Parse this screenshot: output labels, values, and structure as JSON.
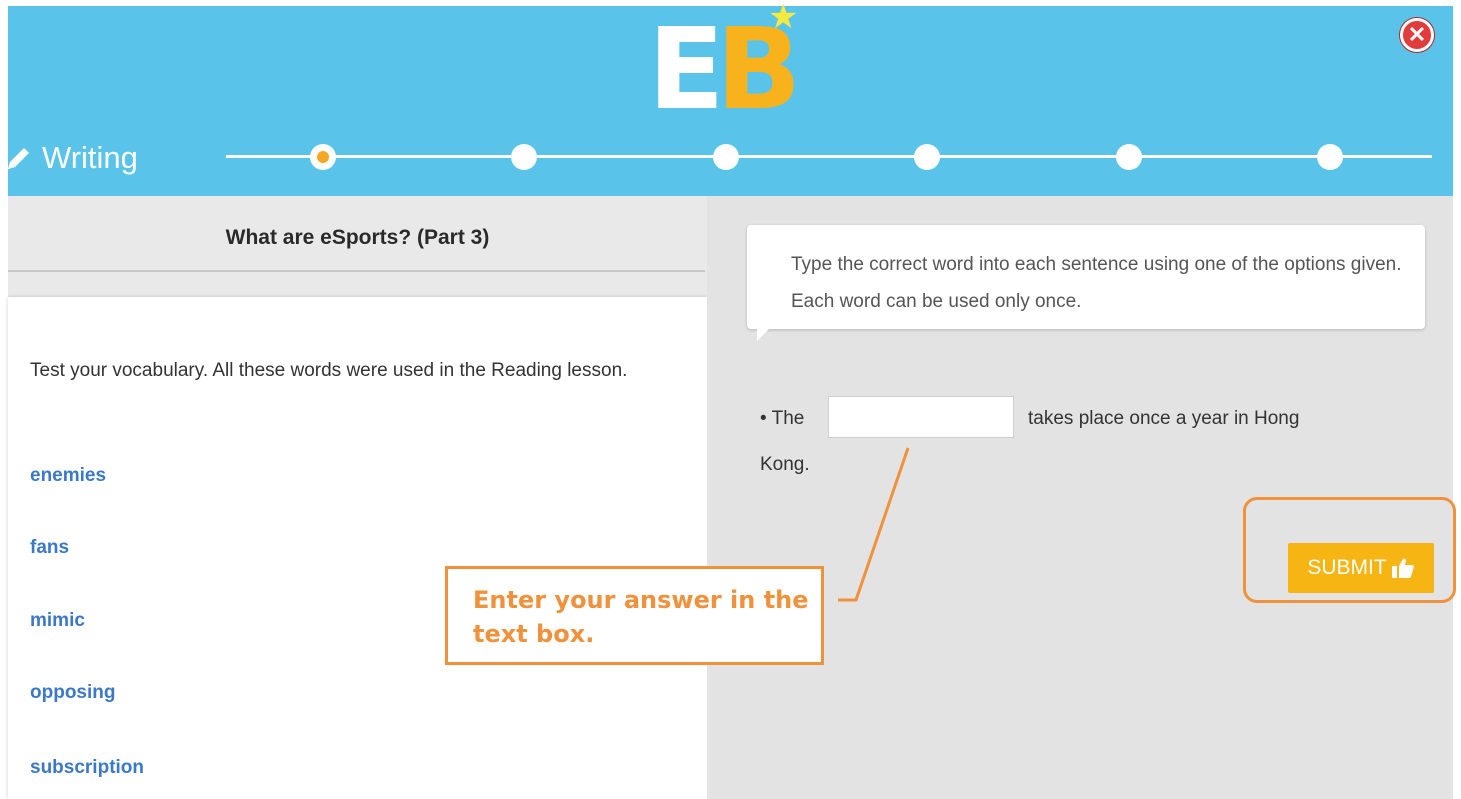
{
  "header": {
    "logo": {
      "text_e": "E",
      "text_b": "B",
      "star": "★"
    },
    "close_icon": "✕",
    "section_title": "Writing",
    "steps": [
      {
        "state": "current"
      },
      {
        "state": "upcoming"
      },
      {
        "state": "upcoming"
      },
      {
        "state": "upcoming"
      },
      {
        "state": "upcoming"
      },
      {
        "state": "upcoming"
      }
    ],
    "colors": {
      "bar": "#5ac3ea",
      "active_step": "#f7a823",
      "logo_b": "#f8b31c"
    }
  },
  "passage": {
    "title": "What are eSports? (Part 3)",
    "intro": "Test your vocabulary. All these words were used in the Reading lesson.",
    "words": [
      "enemies",
      "fans",
      "mimic",
      "opposing",
      "subscription"
    ]
  },
  "task": {
    "instruction": "Type the correct word into each sentence using one of the options given. Each word can be used only once.",
    "sentence_start": "• The",
    "answer_value": "",
    "sentence_end": "takes place once a year in Hong",
    "sentence_end_continued": "Kong.",
    "submit_label": "SUBMIT"
  },
  "tutorial": {
    "callout_text": "Enter your answer in the text box.",
    "color": "#f0913c"
  }
}
